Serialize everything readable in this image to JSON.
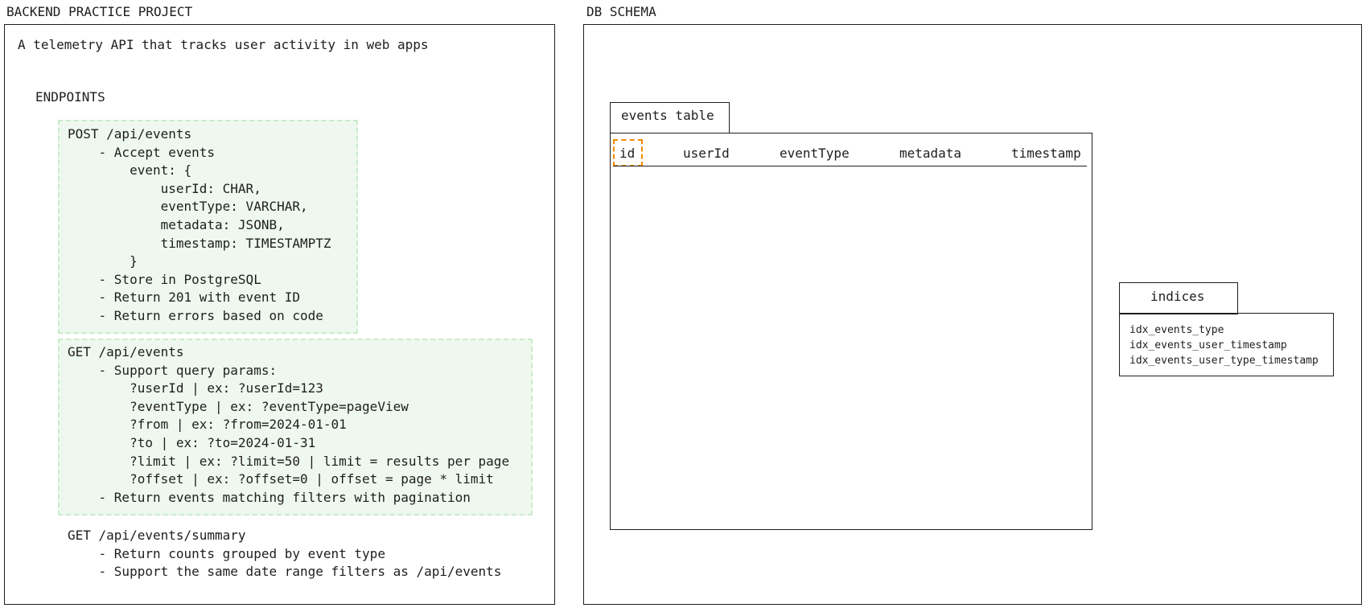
{
  "left_frame": {
    "label": "BACKEND PRACTICE PROJECT",
    "description": "A telemetry API that tracks user activity in web apps",
    "endpoints_heading": "ENDPOINTS",
    "post_block": [
      "POST /api/events",
      "    - Accept events",
      "        event: {",
      "            userId: CHAR,",
      "            eventType: VARCHAR,",
      "            metadata: JSONB,",
      "            timestamp: TIMESTAMPTZ",
      "        }",
      "    - Store in PostgreSQL",
      "    - Return 201 with event ID",
      "    - Return errors based on code"
    ],
    "get_block": [
      "GET /api/events",
      "    - Support query params:",
      "        ?userId | ex: ?userId=123",
      "        ?eventType | ex: ?eventType=pageView",
      "        ?from | ex: ?from=2024-01-01",
      "        ?to | ex: ?to=2024-01-31",
      "        ?limit | ex: ?limit=50 | limit = results per page",
      "        ?offset | ex: ?offset=0 | offset = page * limit",
      "    - Return events matching filters with pagination"
    ],
    "summary_block": [
      "GET /api/events/summary",
      "    - Return counts grouped by event type",
      "    - Support the same date range filters as /api/events"
    ]
  },
  "right_frame": {
    "label": "DB SCHEMA",
    "events_table": {
      "title": "events table",
      "columns": [
        "id",
        "userId",
        "eventType",
        "metadata",
        "timestamp"
      ]
    },
    "indices": {
      "title": "indices",
      "items": [
        "idx_events_type",
        "idx_events_user_timestamp",
        "idx_events_user_type_timestamp"
      ]
    }
  },
  "colors": {
    "stroke": "#1e1e1e",
    "green_fill": "#eff8ef",
    "green_dash": "#c9ebcc",
    "selection": "#f08c00"
  }
}
